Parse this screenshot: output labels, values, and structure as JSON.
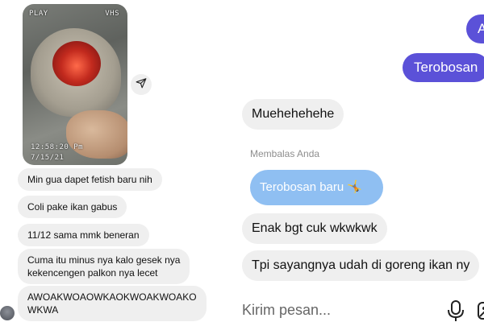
{
  "left_chat": {
    "photo": {
      "osd_mode": "PLAY",
      "osd_format": "VHS",
      "osd_time": "12:58:20 Pm",
      "osd_date": "7/15/21"
    },
    "messages": [
      "Min gua dapet fetish baru nih",
      "Coli pake ikan gabus",
      "11/12 sama mmk beneran",
      "Cuma itu minus nya kalo gesek nya\nkekencengen palkon nya lecet",
      "AWOAKWOAOWKAOKWOAKWOAKO\nWKWA"
    ]
  },
  "right_chat": {
    "sent_messages": [
      "A",
      "Terobosan"
    ],
    "received_messages": [
      "Muehehehehe",
      "Enak bgt cuk wkwkwk",
      "Tpi sayangnya udah di goreng ikan ny"
    ],
    "reply_label": "Membalas Anda",
    "reply_preview": "Terobosan baru 🤸",
    "composer": {
      "placeholder": "Kirim pesan..."
    }
  },
  "colors": {
    "sent_bubble": "#5b51d8",
    "received_bubble": "#efefef",
    "reply_preview_bubble": "#8fbff2"
  },
  "icons": [
    "share-icon",
    "microphone-icon",
    "gallery-icon"
  ]
}
